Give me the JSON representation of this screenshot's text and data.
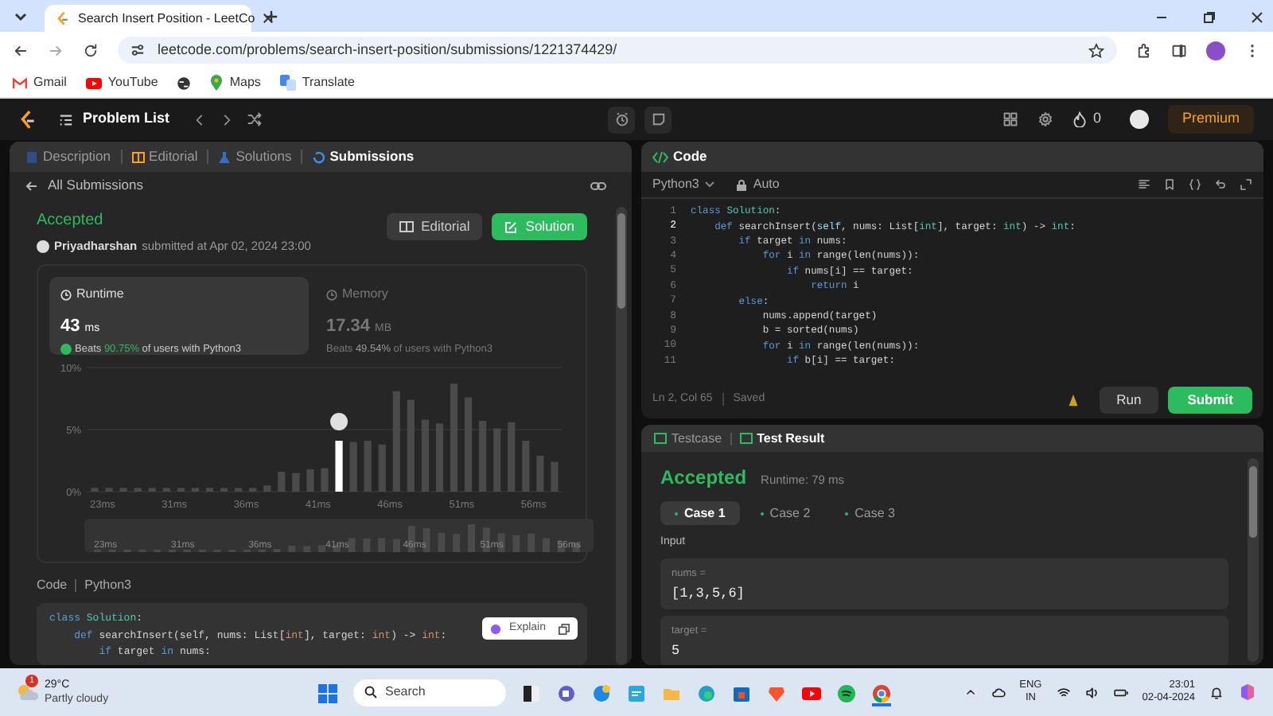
{
  "browser": {
    "tabs": [
      {
        "title": "Search Insert Position - LeetCo",
        "selected": true
      }
    ],
    "url": "leetcode.com/problems/search-insert-position/submissions/1221374429/",
    "bookmarks": [
      {
        "kind": "gmail",
        "label": "Gmail"
      },
      {
        "kind": "youtube",
        "label": "YouTube"
      },
      {
        "kind": "globe"
      },
      {
        "kind": "maps",
        "label": "Maps"
      },
      {
        "kind": "translate",
        "label": "Translate"
      }
    ]
  },
  "navbar": {
    "problem_list": "Problem List",
    "streak": "0",
    "premium": "Premium"
  },
  "left_panel": {
    "tabs": [
      {
        "label": "Description",
        "selected": false
      },
      {
        "label": "Editorial",
        "selected": false
      },
      {
        "label": "Solutions",
        "selected": false
      },
      {
        "label": "Submissions",
        "selected": true
      }
    ],
    "back_link": "All Submissions",
    "status": "Accepted",
    "user": "Priyadharshan",
    "submitted": "submitted at Apr 02, 2024 23:00",
    "buttons": [
      {
        "kind": "editorial",
        "label": "Editorial"
      },
      {
        "kind": "solution",
        "label": "Solution"
      }
    ],
    "stats": [
      {
        "title": "Runtime",
        "value": "43",
        "unit": "ms",
        "beats": "Beats **90.75%** of users with Python3",
        "selected": true
      },
      {
        "title": "Memory",
        "value": "17.34",
        "unit": "MB",
        "beats": "Beats **49.54%** of users with Python3",
        "selected": false
      }
    ],
    "chart_data": {
      "type": "bar",
      "stacked": true,
      "yticks": [
        {
          "value": 0,
          "label": "0%"
        },
        {
          "value": 5,
          "label": "5%"
        },
        {
          "value": 10,
          "label": "10%"
        }
      ],
      "categories": [
        "23ms",
        null,
        null,
        null,
        null,
        "31ms",
        null,
        null,
        null,
        null,
        "36ms",
        null,
        null,
        null,
        null,
        "41ms",
        null,
        null,
        null,
        null,
        "46ms",
        null,
        null,
        null,
        null,
        "51ms",
        null,
        null,
        null,
        null,
        "56ms",
        null,
        null
      ],
      "ylim": [
        0,
        10
      ],
      "series": [
        {
          "color": "#4a4a4a",
          "values": [
            0.3,
            0.3,
            0.3,
            0.3,
            0.3,
            0.3,
            0.3,
            0.3,
            0.3,
            0.3,
            0.3,
            0.3,
            0.5,
            1.6,
            1.5,
            1.8,
            1.9,
            null,
            4.0,
            4.1,
            3.8,
            8.1,
            7.4,
            5.8,
            5.5,
            8.7,
            7.6,
            5.7,
            5.1,
            5.6,
            4.1,
            2.9,
            2.4
          ]
        },
        {
          "color": "#ffffff",
          "values": [
            null,
            null,
            null,
            null,
            null,
            null,
            null,
            null,
            null,
            null,
            null,
            null,
            null,
            null,
            null,
            null,
            null,
            4.1,
            null,
            null,
            null,
            null,
            null,
            null,
            null,
            null,
            null,
            null,
            null,
            null,
            null,
            null,
            null
          ]
        }
      ]
    },
    "navigator_labels": [
      "23ms",
      "31ms",
      "36ms",
      "41ms",
      "46ms",
      "51ms",
      "56ms"
    ],
    "code_label": "Code",
    "language": "Python3",
    "explain": "Explain",
    "code": [
      [
        {
          "kind": "kw",
          "text": "class "
        },
        {
          "kind": "cls",
          "text": "Solution"
        },
        {
          "kind": "p",
          "text": ":"
        }
      ],
      [
        {
          "kind": "kw",
          "text": "    def "
        },
        {
          "kind": "p",
          "text": "searchInsert(self, nums: List["
        },
        {
          "kind": "type",
          "text": "int"
        },
        {
          "kind": "p",
          "text": "], target: "
        },
        {
          "kind": "type",
          "text": "int"
        },
        {
          "kind": "p",
          "text": ") -> "
        },
        {
          "kind": "type",
          "text": "int"
        },
        {
          "kind": "p",
          "text": ":"
        }
      ],
      [
        {
          "kind": "kw",
          "text": "        if "
        },
        {
          "kind": "p",
          "text": "target "
        },
        {
          "kind": "kw",
          "text": "in "
        },
        {
          "kind": "p",
          "text": "nums:"
        }
      ]
    ]
  },
  "editor": {
    "title": "Code",
    "language": "Python3",
    "mode": "Auto",
    "cursor": "Ln 2, Col 65",
    "saved": "Saved",
    "run": "Run",
    "submit": "Submit",
    "lines": [
      {
        "number": "1",
        "current": false,
        "tokens": [
          {
            "kind": "kw",
            "text": "class "
          },
          {
            "kind": "cls",
            "text": "Solution"
          },
          {
            "kind": "p",
            "text": ":"
          }
        ]
      },
      {
        "number": "2",
        "current": true,
        "tokens": [
          {
            "kind": "kw",
            "text": "    def "
          },
          {
            "kind": "p",
            "text": "searchInsert("
          },
          {
            "kind": "var",
            "text": "self"
          },
          {
            "kind": "p",
            "text": ", nums: List["
          },
          {
            "kind": "type",
            "text": "int"
          },
          {
            "kind": "p",
            "text": "], target: "
          },
          {
            "kind": "type",
            "text": "int"
          },
          {
            "kind": "p",
            "text": ") -> "
          },
          {
            "kind": "type",
            "text": "int"
          },
          {
            "kind": "p",
            "text": ":"
          }
        ]
      },
      {
        "number": "3",
        "current": false,
        "tokens": [
          {
            "kind": "kw",
            "text": "        if "
          },
          {
            "kind": "p",
            "text": "target "
          },
          {
            "kind": "kw",
            "text": "in "
          },
          {
            "kind": "p",
            "text": "nums:"
          }
        ]
      },
      {
        "number": "4",
        "current": false,
        "tokens": [
          {
            "kind": "kw",
            "text": "            for "
          },
          {
            "kind": "p",
            "text": "i "
          },
          {
            "kind": "kw",
            "text": "in "
          },
          {
            "kind": "p",
            "text": "range(len(nums)):"
          }
        ]
      },
      {
        "number": "5",
        "current": false,
        "tokens": [
          {
            "kind": "kw",
            "text": "                if "
          },
          {
            "kind": "p",
            "text": "nums[i] == target:"
          }
        ]
      },
      {
        "number": "6",
        "current": false,
        "tokens": [
          {
            "kind": "kw",
            "text": "                    return "
          },
          {
            "kind": "p",
            "text": "i"
          }
        ]
      },
      {
        "number": "7",
        "current": false,
        "tokens": [
          {
            "kind": "kw",
            "text": "        else"
          },
          {
            "kind": "p",
            "text": ":"
          }
        ]
      },
      {
        "number": "8",
        "current": false,
        "tokens": [
          {
            "kind": "p",
            "text": "            nums.append(target)"
          }
        ]
      },
      {
        "number": "9",
        "current": false,
        "tokens": [
          {
            "kind": "p",
            "text": "            b = sorted(nums)"
          }
        ]
      },
      {
        "number": "10",
        "current": false,
        "tokens": [
          {
            "kind": "kw",
            "text": "            for "
          },
          {
            "kind": "p",
            "text": "i "
          },
          {
            "kind": "kw",
            "text": "in "
          },
          {
            "kind": "p",
            "text": "range(len(nums)):"
          }
        ]
      },
      {
        "number": "11",
        "current": false,
        "tokens": [
          {
            "kind": "kw",
            "text": "                if "
          },
          {
            "kind": "p",
            "text": "b[i] == target:"
          }
        ]
      }
    ]
  },
  "results": {
    "tabs": [
      {
        "label": "Testcase",
        "selected": false
      },
      {
        "label": "Test Result",
        "selected": true
      }
    ],
    "status": "Accepted",
    "runtime": "Runtime: 79 ms",
    "cases": [
      {
        "label": "Case 1",
        "selected": true
      },
      {
        "label": "Case 2",
        "selected": false
      },
      {
        "label": "Case 3",
        "selected": false
      }
    ],
    "input_label": "Input",
    "inputs": [
      {
        "name": "nums =",
        "value": "[1,3,5,6]"
      },
      {
        "name": "target =",
        "value": "5"
      }
    ]
  },
  "taskbar": {
    "weather": {
      "temp": "29°C",
      "desc": "Partly cloudy",
      "badge": "1"
    },
    "search_placeholder": "Search",
    "apps": [
      {
        "kind": "windows",
        "selected": false
      },
      {
        "kind": "terminal",
        "selected": false
      },
      {
        "kind": "chat",
        "selected": false
      },
      {
        "kind": "help",
        "selected": false
      },
      {
        "kind": "mail",
        "selected": false
      },
      {
        "kind": "folder",
        "selected": false
      },
      {
        "kind": "edge",
        "selected": false
      },
      {
        "kind": "store",
        "selected": false
      },
      {
        "kind": "brave",
        "selected": false
      },
      {
        "kind": "youtube",
        "selected": false
      },
      {
        "kind": "spotify",
        "selected": false
      },
      {
        "kind": "chrome",
        "selected": true
      }
    ],
    "lang": "ENG",
    "region": "IN",
    "time": "23:01",
    "date": "02-04-2024"
  }
}
